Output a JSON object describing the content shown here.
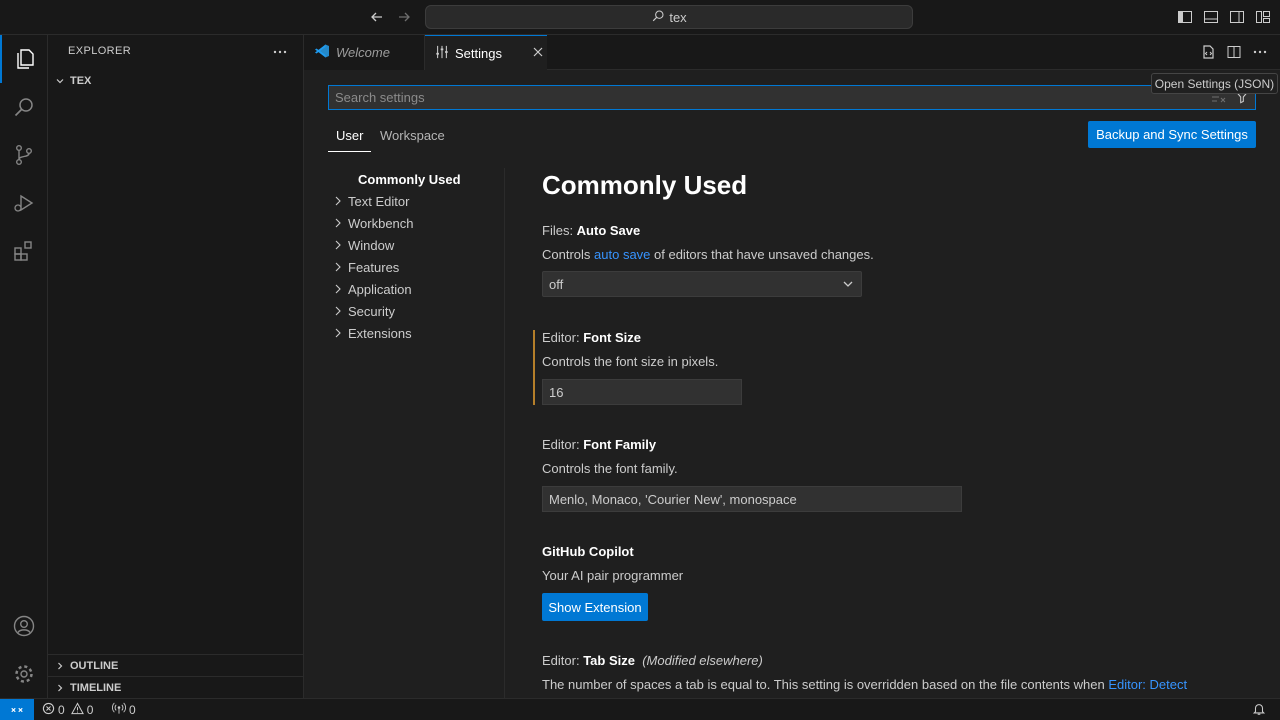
{
  "titlebar": {
    "search_text": "tex",
    "search_icon": "search-icon",
    "back_icon": "arrow-left-icon",
    "forward_icon": "arrow-right-icon",
    "layout_icons": [
      "toggle-primary-sidebar-icon",
      "toggle-panel-icon",
      "toggle-secondary-sidebar-icon",
      "customize-layout-icon"
    ]
  },
  "activitybar": {
    "items": [
      "explorer-icon",
      "search-icon",
      "source-control-icon",
      "run-debug-icon",
      "extensions-icon"
    ],
    "bottom": [
      "accounts-icon",
      "manage-gear-icon"
    ]
  },
  "sidebar": {
    "header": "EXPLORER",
    "folder": "TEX",
    "outline": "OUTLINE",
    "timeline": "TIMELINE"
  },
  "tabs": [
    {
      "label": "Welcome",
      "icon": "vscode-logo-icon"
    },
    {
      "label": "Settings",
      "icon": "settings-sliders-icon"
    }
  ],
  "tooltip": "Open Settings (JSON)",
  "settings": {
    "search_placeholder": "Search settings",
    "scopes": [
      "User",
      "Workspace"
    ],
    "sync_button": "Backup and Sync Settings",
    "toc": [
      "Commonly Used",
      "Text Editor",
      "Workbench",
      "Window",
      "Features",
      "Application",
      "Security",
      "Extensions"
    ],
    "section_title": "Commonly Used",
    "auto_save": {
      "prefix": "Files: ",
      "name": "Auto Save",
      "desc_before": "Controls ",
      "desc_link": "auto save",
      "desc_after": " of editors that have unsaved changes.",
      "value": "off"
    },
    "font_size": {
      "prefix": "Editor: ",
      "name": "Font Size",
      "desc": "Controls the font size in pixels.",
      "value": "16"
    },
    "font_family": {
      "prefix": "Editor: ",
      "name": "Font Family",
      "desc": "Controls the font family.",
      "value": "Menlo, Monaco, 'Courier New', monospace"
    },
    "copilot": {
      "name": "GitHub Copilot",
      "desc": "Your AI pair programmer",
      "button": "Show Extension"
    },
    "tab_size": {
      "prefix": "Editor: ",
      "name": "Tab Size",
      "modified": "(Modified elsewhere)",
      "desc": "The number of spaces a tab is equal to. This setting is overridden based on the file contents when ",
      "desc_link": "Editor: Detect"
    }
  },
  "statusbar": {
    "errors": "0",
    "warnings": "0",
    "ports": "0"
  },
  "colors": {
    "accent": "#0078d4",
    "link": "#3794ff",
    "modified": "#b57f2a"
  }
}
